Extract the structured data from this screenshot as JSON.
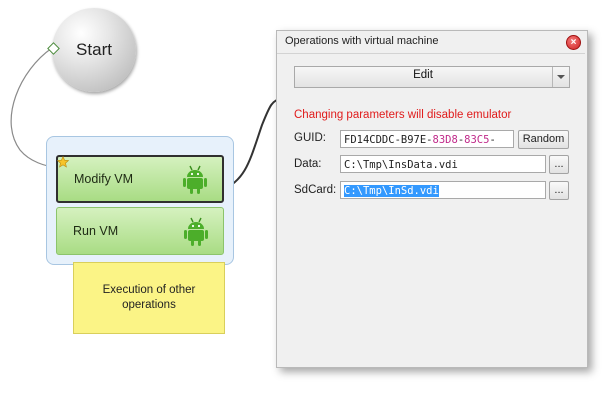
{
  "canvas": {
    "start_node": {
      "label": "Start"
    },
    "group": {
      "actions": [
        {
          "label": "Modify VM",
          "icon": "android-icon",
          "selected": true,
          "has_star": true
        },
        {
          "label": "Run VM",
          "icon": "android-icon",
          "selected": false
        }
      ]
    },
    "note": {
      "line1": "Execution of other",
      "line2": "operations"
    }
  },
  "dialog": {
    "title": "Operations with virtual machine",
    "close_icon": "close-icon",
    "mode_select": {
      "value": "Edit"
    },
    "warning": "Changing parameters will disable emulator",
    "guid": {
      "label": "GUID:",
      "value_parts": [
        "FD14CDDC-B97E-",
        "83D8",
        "-",
        "83C5",
        "-"
      ],
      "button": "Random"
    },
    "data": {
      "label": "Data:",
      "value": "C:\\Tmp\\InsData.vdi",
      "browse": "..."
    },
    "sdcard": {
      "label": "SdCard:",
      "value": "C:\\Tmp\\InSd.vdi",
      "browse": "..."
    }
  },
  "colors": {
    "warning": "#e01b1b",
    "action_green": "#a9dc84",
    "note_yellow": "#fbf486",
    "group_blue": "#e7f1fb",
    "selection": "#3399ff"
  }
}
